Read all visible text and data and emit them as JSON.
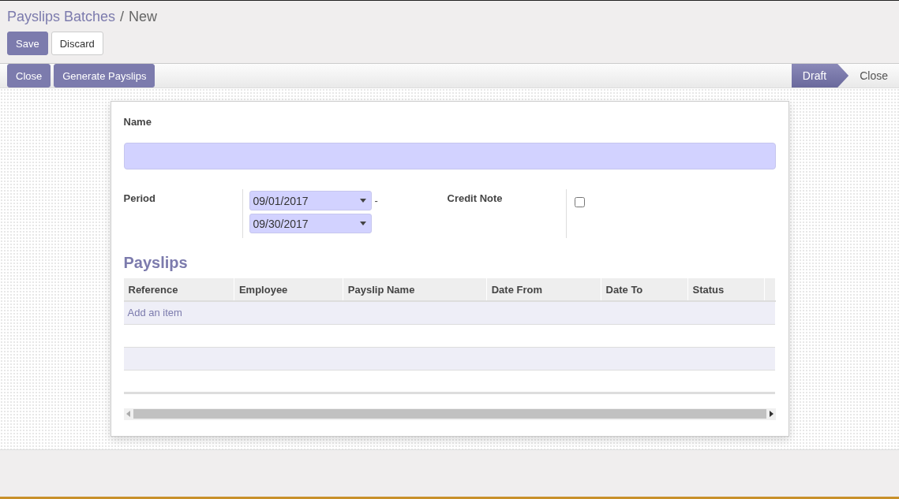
{
  "breadcrumb": {
    "parent": "Payslips Batches",
    "separator": "/",
    "current": "New"
  },
  "actions": [
    {
      "label": "Save",
      "kind": "primary"
    },
    {
      "label": "Discard",
      "kind": "secondary"
    }
  ],
  "header_buttons": [
    "Close",
    "Generate Payslips"
  ],
  "stages": [
    {
      "label": "Draft",
      "selected": true
    },
    {
      "label": "Close",
      "selected": false
    }
  ],
  "form": {
    "name_label": "Name",
    "period_label": "Period",
    "date_from": "09/01/2017",
    "date_separator": "-",
    "date_to": "09/30/2017",
    "credit_note_label": "Credit Note",
    "credit_note_checked": false
  },
  "payslips": {
    "title": "Payslips",
    "columns": [
      "Reference",
      "Employee",
      "Payslip Name",
      "Date From",
      "Date To",
      "Status"
    ],
    "add_item": "Add an item"
  }
}
